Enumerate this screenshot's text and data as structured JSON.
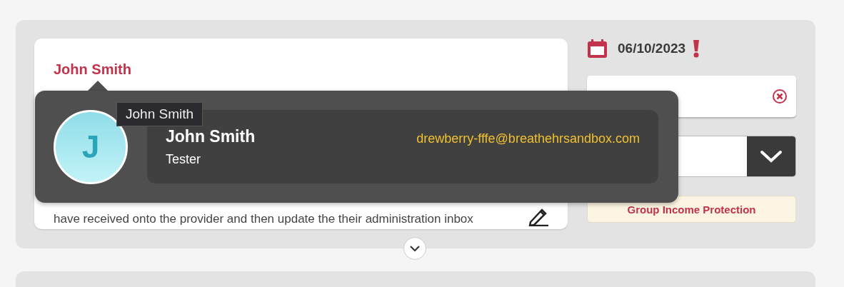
{
  "card": {
    "author": "John Smith",
    "body": "have received onto the provider and then update the their administration inbox"
  },
  "side": {
    "date": "06/10/2023",
    "overdue": true,
    "tag": "Group Income Protection"
  },
  "popover": {
    "initial": "J",
    "name": "John Smith",
    "role": "Tester",
    "email": "drewberry-fffe@breathehrsandbox.com",
    "tooltip": "John Smith"
  }
}
